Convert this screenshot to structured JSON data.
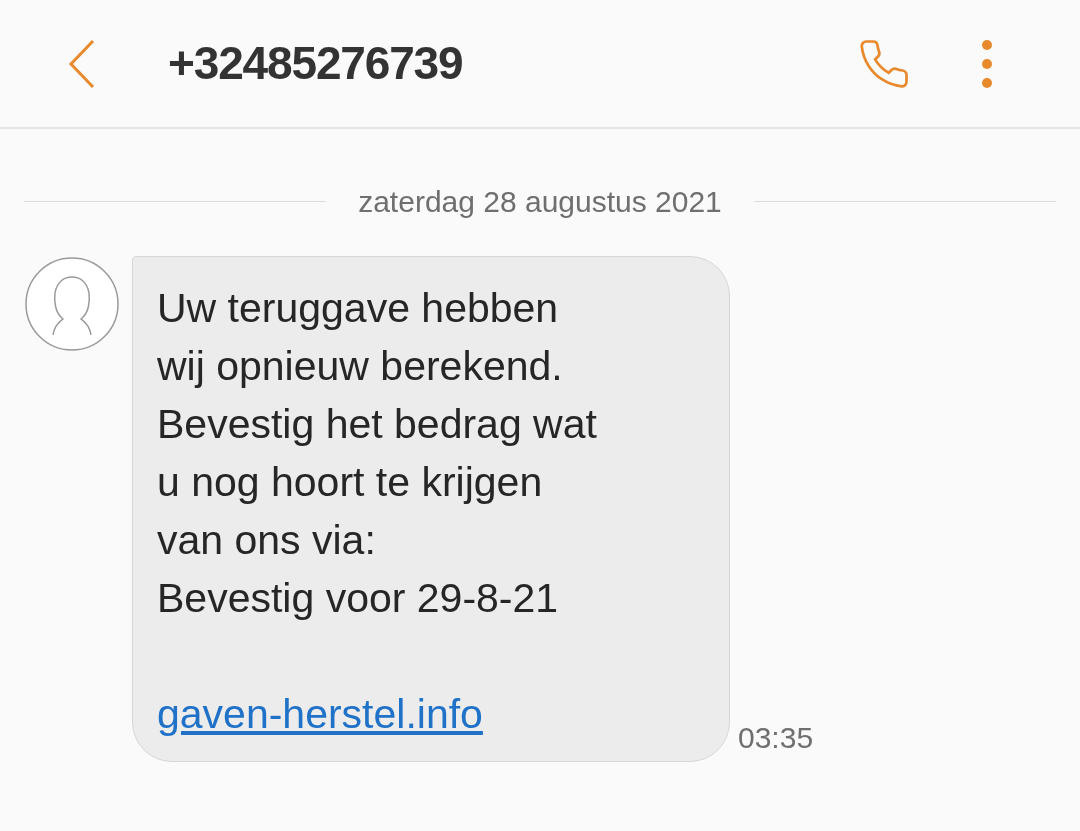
{
  "header": {
    "title": "+32485276739"
  },
  "date_separator": "zaterdag 28 augustus 2021",
  "message": {
    "text": "Uw teruggave hebben\nwij opnieuw berekend.\nBevestig het bedrag wat\nu nog hoort te krijgen\nvan ons via:\nBevestig voor 29-8-21",
    "link": "gaven-herstel.info",
    "time": "03:35"
  }
}
